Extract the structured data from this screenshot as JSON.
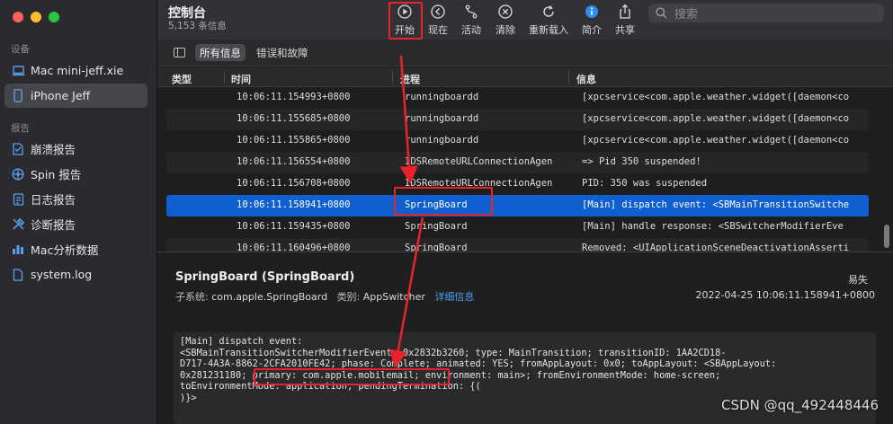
{
  "window": {
    "title": "控制台",
    "subtitle": "5,153 条信息"
  },
  "sidebar": {
    "devices_header": "设备",
    "devices": [
      {
        "label": "Mac mini-jeff.xie",
        "icon": "laptop-icon",
        "selected": false
      },
      {
        "label": "iPhone Jeff",
        "icon": "iphone-icon",
        "selected": true
      }
    ],
    "reports_header": "报告",
    "reports": [
      {
        "label": "崩溃报告",
        "icon": "crash-report-icon"
      },
      {
        "label": "Spin 报告",
        "icon": "spin-report-icon"
      },
      {
        "label": "日志报告",
        "icon": "log-report-icon"
      },
      {
        "label": "诊断报告",
        "icon": "diagnostic-report-icon"
      },
      {
        "label": "Mac分析数据",
        "icon": "analytics-icon"
      },
      {
        "label": "system.log",
        "icon": "document-icon"
      }
    ]
  },
  "toolbar": {
    "start": "开始",
    "now": "现在",
    "activities": "活动",
    "clear": "清除",
    "reload": "重新载入",
    "info": "简介",
    "share": "共享",
    "search_placeholder": "搜索"
  },
  "filters": {
    "all": "所有信息",
    "errors": "错误和故障"
  },
  "table": {
    "headers": {
      "type": "类型",
      "time": "时间",
      "process": "进程",
      "message": "信息"
    },
    "rows": [
      {
        "time": "10:06:11.154993+0800",
        "process": "runningboardd",
        "message": "[xpcservice<com.apple.weather.widget([daemon<co"
      },
      {
        "time": "10:06:11.155685+0800",
        "process": "runningboardd",
        "message": "[xpcservice<com.apple.weather.widget([daemon<co"
      },
      {
        "time": "10:06:11.155865+0800",
        "process": "runningboardd",
        "message": "[xpcservice<com.apple.weather.widget([daemon<co"
      },
      {
        "time": "10:06:11.156554+0800",
        "process": "IDSRemoteURLConnectionAgen",
        "message": " => Pid 350 suspended!"
      },
      {
        "time": "10:06:11.156708+0800",
        "process": "IDSRemoteURLConnectionAgen",
        "message": "PID: 350 was suspended"
      },
      {
        "time": "10:06:11.158941+0800",
        "process": "SpringBoard",
        "message": "[Main] dispatch event: <SBMainTransitionSwitche"
      },
      {
        "time": "10:06:11.159435+0800",
        "process": "SpringBoard",
        "message": "[Main] handle response: <SBSwitcherModifierEve"
      },
      {
        "time": "10:06:11.160496+0800",
        "process": "SpringBoard",
        "message": "Removed: <UIApplicationSceneDeactivationAsserti"
      }
    ],
    "selected_index": 5
  },
  "detail": {
    "title": "SpringBoard (SpringBoard)",
    "level": "易失",
    "subsystem_label": "子系统:",
    "subsystem": "com.apple.SpringBoard",
    "category_label": "类别:",
    "category": "AppSwitcher",
    "more_link": "详细信息",
    "date": "2022-04-25 10:06:11.158941+0800",
    "message_lines": [
      "[Main] dispatch event:",
      "<SBMainTransitionSwitcherModifierEvent: 0x2832b3260; type: MainTransition; transitionID: 1AA2CD18-",
      "D717-4A3A-8862-2CFA2010FE42; phase: Complete; animated: YES; fromAppLayout: 0x0; toAppLayout: <SBAppLayout:",
      "0x281231180; primary: com.apple.mobilemail; environment: main>; fromEnvironmentMode: home-screen;",
      "toEnvironmentMode: application; pendingTermination: {(",
      ")}>"
    ]
  },
  "watermark": "CSDN @qq_492448446",
  "colors": {
    "selection": "#0f5fd0",
    "annotation": "#e8242a",
    "link": "#4a9df5"
  }
}
